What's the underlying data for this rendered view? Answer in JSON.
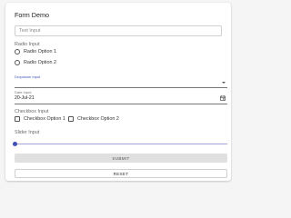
{
  "form": {
    "title": "Form Demo",
    "text_input": {
      "placeholder": "Text Input",
      "value": ""
    },
    "radio": {
      "label": "Radio Input",
      "options": [
        "Radio Option 1",
        "Radio Option 2"
      ]
    },
    "dropdown": {
      "label": "Dropdown Input",
      "value": ""
    },
    "date": {
      "label": "Date Input",
      "value": "20-Jul-21"
    },
    "checkbox": {
      "label": "Checkbox Input",
      "options": [
        "Checkbox Option 1",
        "Checkbox Option 2"
      ]
    },
    "slider": {
      "label": "Slider Input",
      "value": 0
    },
    "submit_label": "SUBMIT",
    "reset_label": "RESET"
  },
  "colors": {
    "accent": "#3f51b5",
    "slider_track": "#9fa8da",
    "submit_bg": "#e0e0e0",
    "page_bg": "#f5f5f5"
  },
  "icons": {
    "dropdown": "chevron-down-icon",
    "date": "calendar-icon"
  }
}
